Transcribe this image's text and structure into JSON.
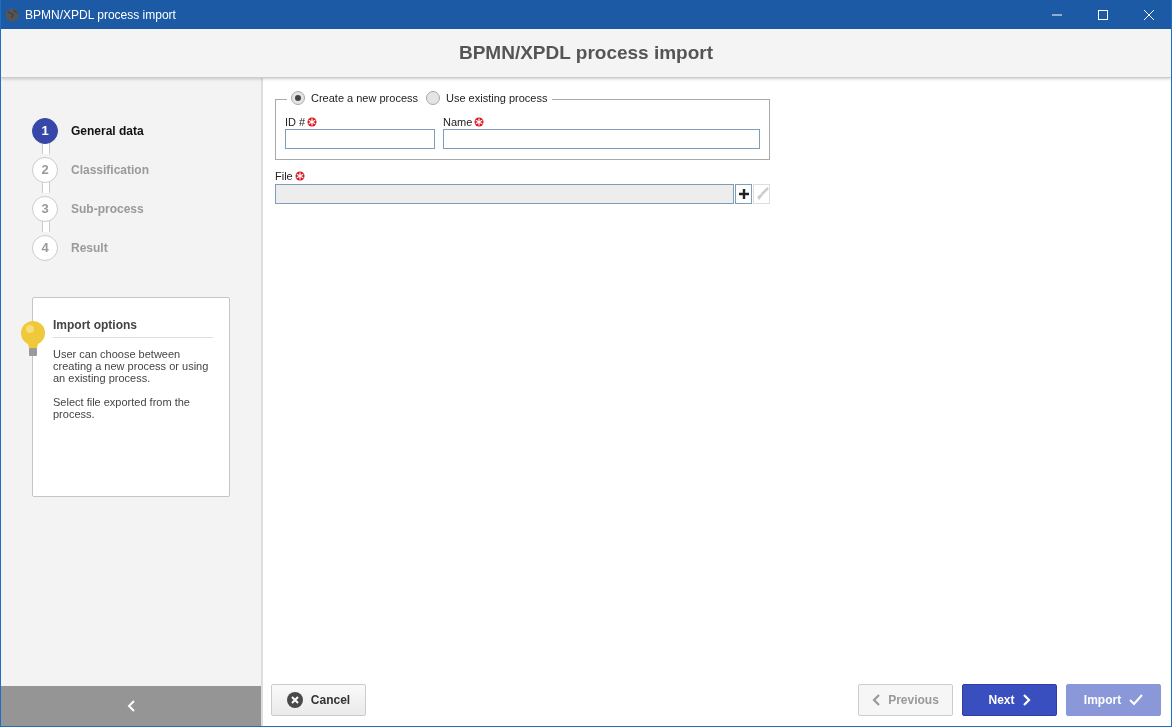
{
  "window": {
    "title": "BPMN/XPDL process import"
  },
  "header": {
    "title": "BPMN/XPDL process import"
  },
  "steps": [
    {
      "number": "1",
      "label": "General data",
      "selected": true
    },
    {
      "number": "2",
      "label": "Classification",
      "selected": false
    },
    {
      "number": "3",
      "label": "Sub-process",
      "selected": false
    },
    {
      "number": "4",
      "label": "Result",
      "selected": false
    }
  ],
  "tip": {
    "title": "Import options",
    "paragraphs": [
      "User can choose between creating a new process or using an existing process.",
      "Select file exported from the process."
    ]
  },
  "mode": [
    {
      "label": "Create a new process",
      "selected": true
    },
    {
      "label": "Use existing process",
      "selected": false
    }
  ],
  "fields": [
    {
      "label": "ID #",
      "required": true
    },
    {
      "label": "Name",
      "required": true
    }
  ],
  "file": {
    "label": "File",
    "required": true,
    "disabled": true
  },
  "buttons": [
    {
      "kind": "cancel",
      "label": "Cancel",
      "disabled": false
    },
    {
      "kind": "previous",
      "label": "Previous",
      "disabled": true
    },
    {
      "kind": "next",
      "label": "Next",
      "disabled": false
    },
    {
      "kind": "import",
      "label": "Import",
      "disabled": true
    }
  ]
}
